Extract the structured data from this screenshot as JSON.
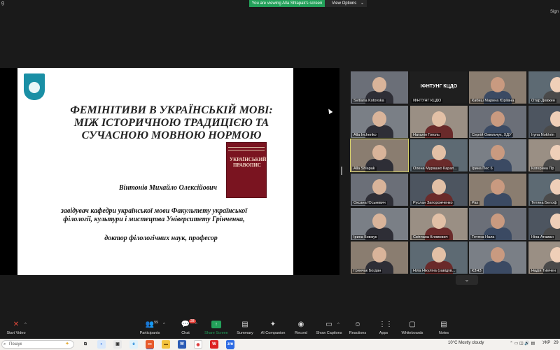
{
  "top_bar": {
    "left_fragment": "g",
    "share_banner": "You are viewing Alla Shlapak's screen",
    "view_options": "View Options",
    "right_fragment": "Sign"
  },
  "slide": {
    "title": "ФЕМІНІТИВИ В УКРАЇНСЬКІЙ МОВІ: МІЖ ІСТОРИЧНОЮ ТРАДИЦІЄЮ ТА СУЧАСНОЮ МОВНОЮ НОРМОЮ",
    "book_title": "УКРАЇНСЬКИЙ ПРАВОПИС",
    "author": "Вінтонів Михайло Олексійович",
    "position": "завідувач кафедри української мови Факультету української філології, культури і мистецтва Університету Грінченка,",
    "degree": "доктор філологічних наук, професор"
  },
  "gallery": [
    {
      "name": "Svitlana Kotovska"
    },
    {
      "name": "ІФНТУНГ КЦДО",
      "label": "ІФНТУНГ КЦДО"
    },
    {
      "name": "Кабиш Марина Юріївна"
    },
    {
      "name": "Отар Довжен"
    },
    {
      "name": "Alla Ivchenko"
    },
    {
      "name": "Наталія Гоголь"
    },
    {
      "name": "Сергій Омельчук, ХДУ"
    },
    {
      "name": "Iryna Nokhrin"
    },
    {
      "name": "Alla Shlapak",
      "active": true
    },
    {
      "name": "Олена Мурашко Карап..."
    },
    {
      "name": "Ірина Пес 6"
    },
    {
      "name": "Катерина Пр"
    },
    {
      "name": "Оксана Юськевич"
    },
    {
      "name": "Руслан Запорожченко"
    },
    {
      "name": "Рах"
    },
    {
      "name": "Тетяна Белоф"
    },
    {
      "name": "Ірина Ковжук"
    },
    {
      "name": "Світлана Климович"
    },
    {
      "name": "Тетяна Нала"
    },
    {
      "name": "Ніна Атаман"
    },
    {
      "name": "Гринчак Богдан"
    },
    {
      "name": "Ніла Нікуліна (завідув..."
    },
    {
      "name": "КЗНЗ"
    },
    {
      "name": "Надія Тимчен"
    }
  ],
  "toolbar": {
    "start_video": "Start Video",
    "participants": "Participants",
    "participants_count": "99",
    "chat": "Chat",
    "chat_badge": "28",
    "share_screen": "Share Screen",
    "summary": "Summary",
    "ai_companion": "AI Companion",
    "record": "Record",
    "show_captions": "Show Captions",
    "reactions": "Reactions",
    "apps": "Apps",
    "whiteboards": "Whiteboards",
    "notes": "Notes"
  },
  "taskbar": {
    "search_placeholder": "Пошук",
    "weather": "10°C  Mostly cloudy",
    "language": "УКР",
    "clock_fragment": "29"
  },
  "colors": {
    "share_green": "#23a15a",
    "meeting_bg": "#1a1a1a",
    "book_red": "#7a1420"
  }
}
